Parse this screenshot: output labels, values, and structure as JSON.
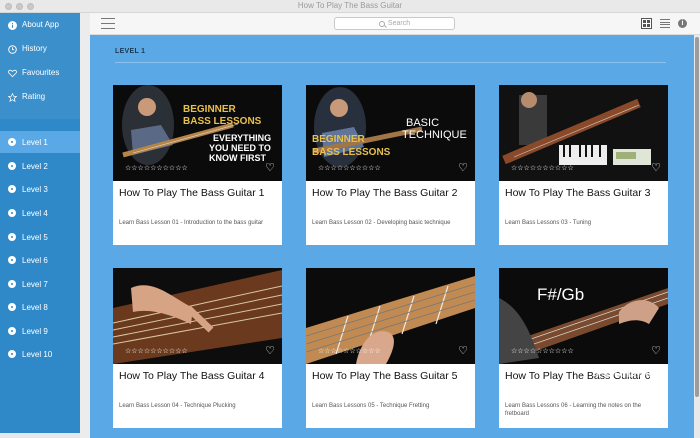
{
  "window": {
    "title": "How To Play The Bass Guitar"
  },
  "sidebar": {
    "top_items": [
      {
        "label": "About App",
        "icon": "info-icon"
      },
      {
        "label": "History",
        "icon": "clock-icon"
      },
      {
        "label": "Favourites",
        "icon": "heart-icon"
      },
      {
        "label": "Rating",
        "icon": "star-icon"
      }
    ],
    "levels": [
      "Level 1",
      "Level 2",
      "Level 3",
      "Level 4",
      "Level 5",
      "Level 6",
      "Level 7",
      "Level 8",
      "Level 9",
      "Level 10"
    ],
    "active_level": "Level 1"
  },
  "toolbar": {
    "search_placeholder": "Search"
  },
  "section": {
    "title": "LEVEL 1"
  },
  "cards": [
    {
      "title": "How To Play The Bass Guitar 1",
      "desc": "Learn Bass Lesson 01 - Introduction to the bass guitar",
      "thumb": {
        "l1": "BEGINNER",
        "l2": "BASS LESSONS",
        "l3": "EVERYTHING",
        "l4": "YOU NEED TO",
        "l5": "KNOW FIRST"
      }
    },
    {
      "title": "How To Play The Bass Guitar 2",
      "desc": "Learn Bass Lesson 02 - Developing basic technique",
      "thumb": {
        "l1": "BASIC",
        "l2": "TECHNIQUE",
        "l3": "BEGINNER",
        "l4": "BASS LESSONS"
      }
    },
    {
      "title": "How To Play The Bass Guitar 3",
      "desc": "Learn Bass Lessons 03 - Tuning",
      "thumb": {}
    },
    {
      "title": "How To Play The Bass Guitar 4",
      "desc": "Learn Bass Lesson 04 - Technique Plucking",
      "thumb": {}
    },
    {
      "title": "How To Play The Bass Guitar 5",
      "desc": "Learn Bass Lessons 05 - Technique Fretting",
      "thumb": {}
    },
    {
      "title": "How To Play The Bass Guitar 6",
      "desc": "Learn Bass Lessons 06 - Learning the notes on the fretboard",
      "thumb": {
        "l1": "F#/Gb"
      }
    }
  ],
  "rating_stars": "☆☆☆☆☆☆☆☆☆☆",
  "watermark": "PConline",
  "colors": {
    "sidebar": "#2f89c8",
    "content": "#5aa9e6",
    "thumb_text": "#e9c04a"
  }
}
